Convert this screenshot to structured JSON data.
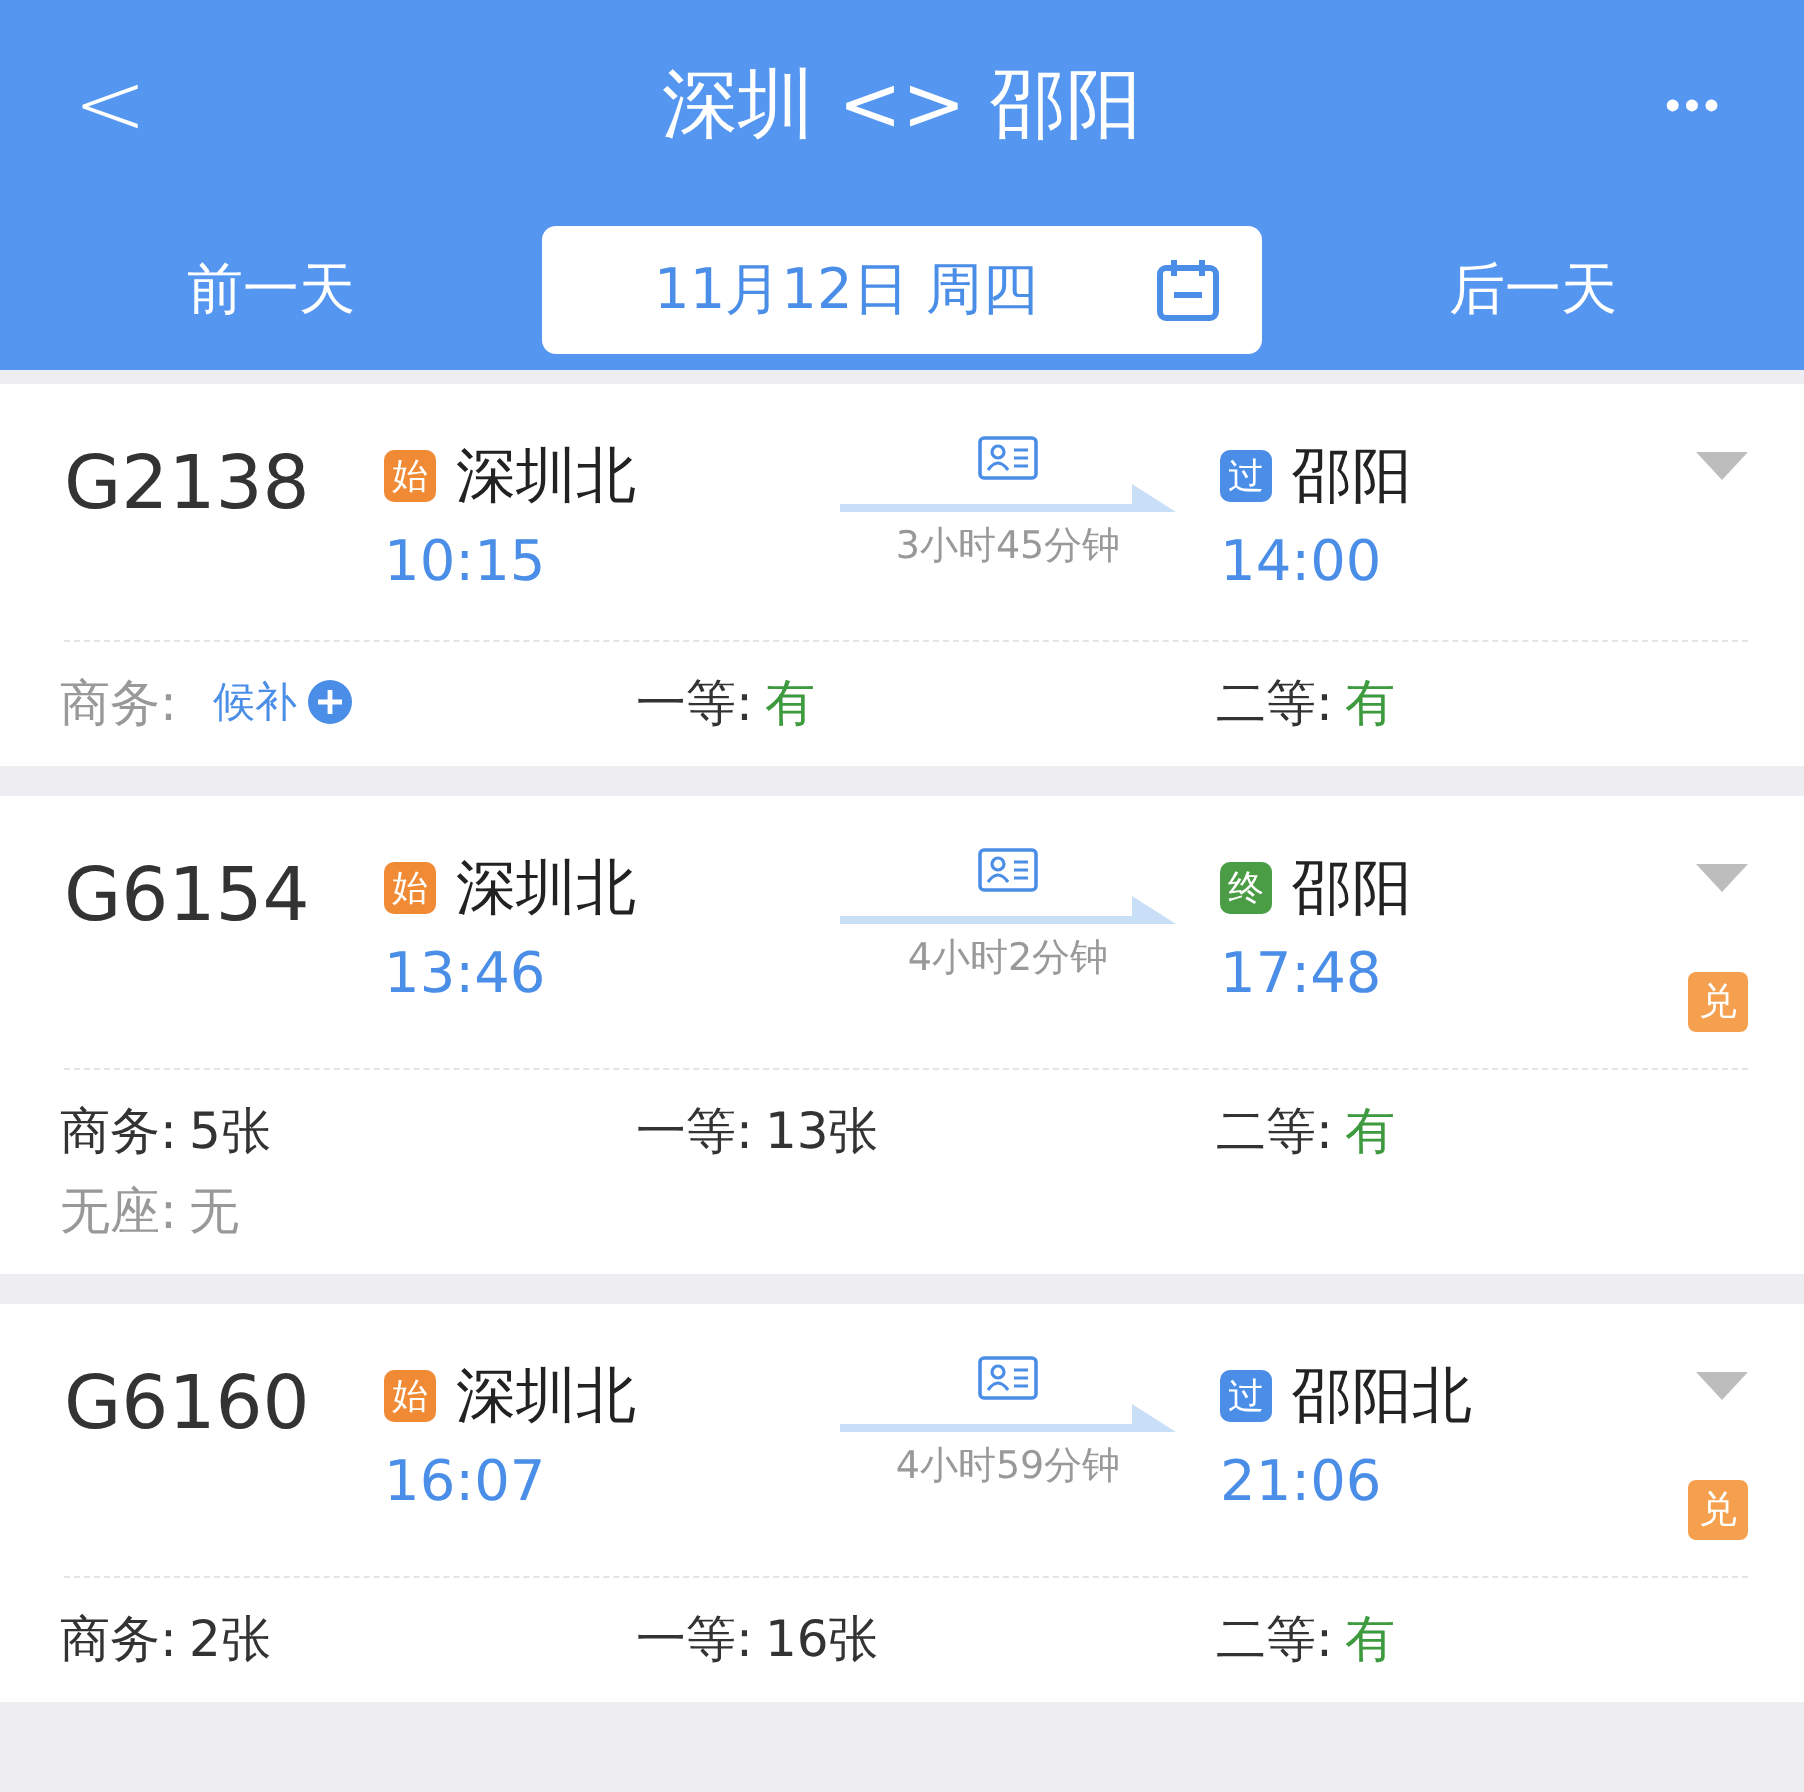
{
  "header": {
    "back": "<",
    "title": "深圳 <> 邵阳",
    "more": "•••",
    "prev_day": "前一天",
    "date": "11月12日 周四",
    "next_day": "后一天"
  },
  "trains": [
    {
      "number": "G2138",
      "from": {
        "badge": "始",
        "color": "#f08a35",
        "station": "深圳北",
        "time": "10:15"
      },
      "duration": "3小时45分钟",
      "to": {
        "badge": "过",
        "color": "#4a8ee8",
        "station": "邵阳",
        "time": "14:00"
      },
      "seats": [
        {
          "label": "商务:",
          "value": "候补",
          "kind": "waitlist"
        },
        {
          "label": "一等:",
          "value": "有",
          "kind": "available"
        },
        {
          "label": "二等:",
          "value": "有",
          "kind": "available"
        }
      ]
    },
    {
      "number": "G6154",
      "from": {
        "badge": "始",
        "color": "#f08a35",
        "station": "深圳北",
        "time": "13:46"
      },
      "duration": "4小时2分钟",
      "to": {
        "badge": "终",
        "color": "#4a9c45",
        "station": "邵阳",
        "time": "17:48"
      },
      "exchange": "兑",
      "seats": [
        {
          "label": "商务:",
          "value": "5张",
          "kind": "tickets"
        },
        {
          "label": "一等:",
          "value": "13张",
          "kind": "tickets"
        },
        {
          "label": "二等:",
          "value": "有",
          "kind": "available"
        },
        {
          "label": "无座:",
          "value": "无",
          "kind": "sold_out"
        }
      ]
    },
    {
      "number": "G6160",
      "from": {
        "badge": "始",
        "color": "#f08a35",
        "station": "深圳北",
        "time": "16:07"
      },
      "duration": "4小时59分钟",
      "to": {
        "badge": "过",
        "color": "#4a8ee8",
        "station": "邵阳北",
        "time": "21:06"
      },
      "exchange": "兑",
      "seats": [
        {
          "label": "商务:",
          "value": "2张",
          "kind": "tickets"
        },
        {
          "label": "一等:",
          "value": "16张",
          "kind": "tickets"
        },
        {
          "label": "二等:",
          "value": "有",
          "kind": "available"
        }
      ]
    }
  ]
}
